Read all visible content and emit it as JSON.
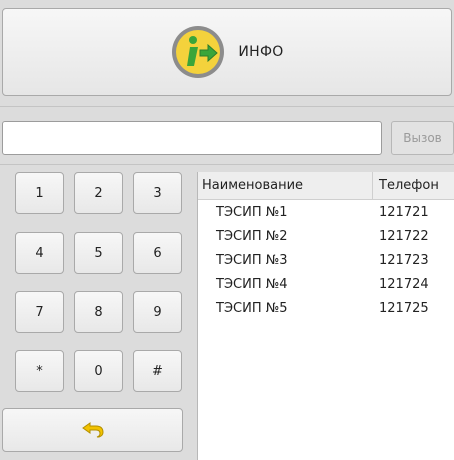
{
  "header": {
    "info_label": "ИНФО",
    "info_icon": "info-arrow-icon"
  },
  "dial": {
    "input_value": "",
    "call_label": "Вызов"
  },
  "keypad": {
    "keys": [
      "1",
      "2",
      "3",
      "4",
      "5",
      "6",
      "7",
      "8",
      "9",
      "*",
      "0",
      "#"
    ],
    "back_icon": "return-arrow-icon"
  },
  "contacts": {
    "columns": {
      "name": "Наименование",
      "phone": "Телефон"
    },
    "rows": [
      {
        "name": "ТЭСИП №1",
        "phone": "121721"
      },
      {
        "name": "ТЭСИП №2",
        "phone": "121722"
      },
      {
        "name": "ТЭСИП №3",
        "phone": "121723"
      },
      {
        "name": "ТЭСИП №4",
        "phone": "121724"
      },
      {
        "name": "ТЭСИП №5",
        "phone": "121725"
      }
    ]
  },
  "colors": {
    "icon_yellow": "#f4d23c",
    "icon_green": "#3aa53a",
    "icon_ring": "#8c8c8c",
    "back_arrow": "#e6b800"
  }
}
